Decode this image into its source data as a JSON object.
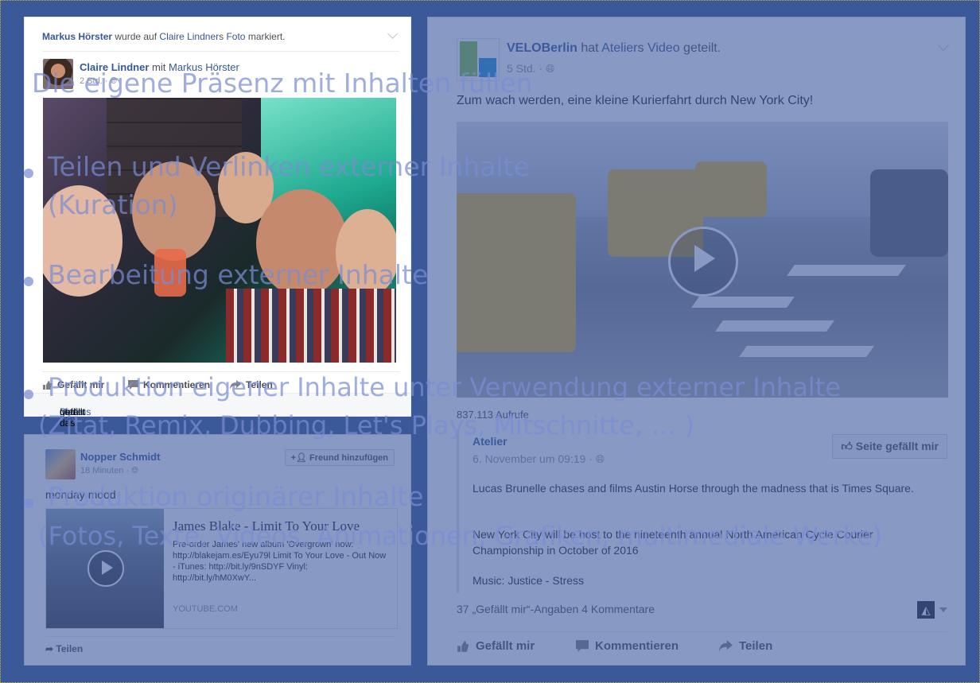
{
  "card1": {
    "header_actor": "Markus Hörster",
    "header_mid": " wurde auf ",
    "header_owner": "Claire Lindner",
    "header_suffix_s": "s ",
    "header_photo": "Foto",
    "header_end": " markiert.",
    "author": "Claire Lindner",
    "with_word": " mit ",
    "with_name": "Markus Hörster",
    "time": "2 Std. · ",
    "actions": {
      "like": "Gefällt mir",
      "comment": "Kommentieren",
      "share": "Teilen"
    },
    "likes_name1": "Markus Hörster",
    "likes_and": " und ",
    "likes_name2": "Dieter Veit",
    "likes_end": " gefällt das."
  },
  "card2": {
    "author": "Nopper Schmidt",
    "time": "18 Minuten · ",
    "add_friend": "Freund hinzufügen",
    "text": "monday mood",
    "share_title": "James Blake - Limit To Your Love",
    "share_desc": "Pre-order James' new album 'Overgrown' now: http://blakejam.es/Eyu79l Limit To Your Love - Out Now - iTunes: http://bit.ly/9nSDYF Vinyl: http://bit.ly/hM0XwY...",
    "share_domain": "YOUTUBE.COM",
    "share_button": "Teilen"
  },
  "card3": {
    "page": "VELOBerlin",
    "shared_mid": " hat ",
    "shared_owner": "Atelier",
    "shared_s": "s ",
    "shared_video": "Video",
    "shared_end": " geteilt.",
    "time": "5 Std. · ",
    "text": "Zum wach werden, eine kleine Kurierfahrt durch New York City!",
    "views": "837.113 Aufrufe",
    "quote_page": "Atelier",
    "quote_time": "6. November um 09:19 · ",
    "like_page": "Seite gefällt mir",
    "quote_line1": "Lucas Brunelle chases and films Austin Horse through the madness that is Times Square.",
    "quote_line2": "New York City will be host to the nineteenth annual North American Cycle Courier Championship in October of 2016",
    "quote_line3": "Music: Justice - Stress",
    "stats": "37 „Gefällt mir“-Angaben  4 Kommentare",
    "actions": {
      "like": "Gefällt mir",
      "comment": "Kommentieren",
      "share": "Teilen"
    }
  },
  "slide": {
    "title": "Die eigene Präsenz mit Inhalten füllen",
    "b1_line1": "Teilen und Verlinken externer Inhalte",
    "b1_line2": "(Kuration)",
    "b2": "Bearbeitung externer Inhalte",
    "b3_line1": "Produktion eigener Inhalte unter Verwendung externer Inhalte",
    "b3_line2": "(Zitat, Remix, Dubbing, Let's Plays, Mitschnitte, … )",
    "b4_line1": "Produktion originärer Inhalte",
    "b4_line2": "(Fotos, Texte, Videos, Animationen, Grafiken, multimediale Werke)"
  }
}
